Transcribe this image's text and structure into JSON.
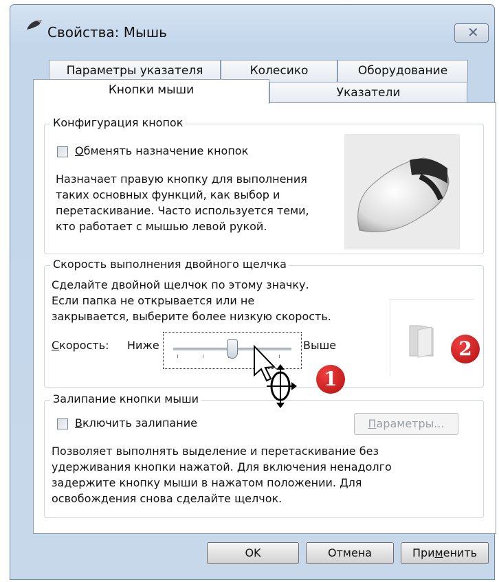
{
  "window": {
    "title": "Свойства: Мышь",
    "close_label": "✕"
  },
  "tabs": {
    "row_back": [
      "Параметры указателя",
      "Колесико",
      "Оборудование"
    ],
    "row_front": [
      "Кнопки мыши",
      "Указатели"
    ],
    "active": "Кнопки мыши"
  },
  "button_config": {
    "legend": "Конфигурация кнопок",
    "swap_checkbox": {
      "label_accel": "О",
      "label_rest": "бменять назначение кнопок",
      "checked": false
    },
    "description": [
      "Назначает правую кнопку для выполнения",
      "таких основных функций, как выбор и",
      "перетаскивание. Часто используется теми,",
      "кто работает с мышью левой рукой."
    ]
  },
  "double_click": {
    "legend": "Скорость выполнения двойного щелчка",
    "description": [
      "Сделайте двойной щелчок по этому значку.",
      "Если папка не открывается или не",
      "закрывается, выберите более низкую скорость."
    ],
    "speed_label_accel": "С",
    "speed_label_rest": "корость:",
    "slower": "Ниже",
    "faster": "Выше",
    "speed_value_fraction": 0.5
  },
  "click_lock": {
    "legend": "Залипание кнопки мыши",
    "enable_checkbox": {
      "label_accel": "В",
      "label_rest": "ключить залипание",
      "checked": false
    },
    "settings_button": {
      "accel": "П",
      "rest": "араметры..."
    },
    "description": [
      "Позволяет выполнять выделение и перетаскивание без",
      "удерживания кнопки нажатой. Для включения ненадолго",
      "задержите кнопку мыши в нажатом положении. Для",
      "освобождения снова сделайте щелчок."
    ]
  },
  "footer": {
    "ok": "OK",
    "cancel": "Отмена",
    "apply_before": "При",
    "apply_accel": "м",
    "apply_after": "енить"
  },
  "callouts": {
    "one": "1",
    "two": "2",
    "color": "#c41616"
  }
}
